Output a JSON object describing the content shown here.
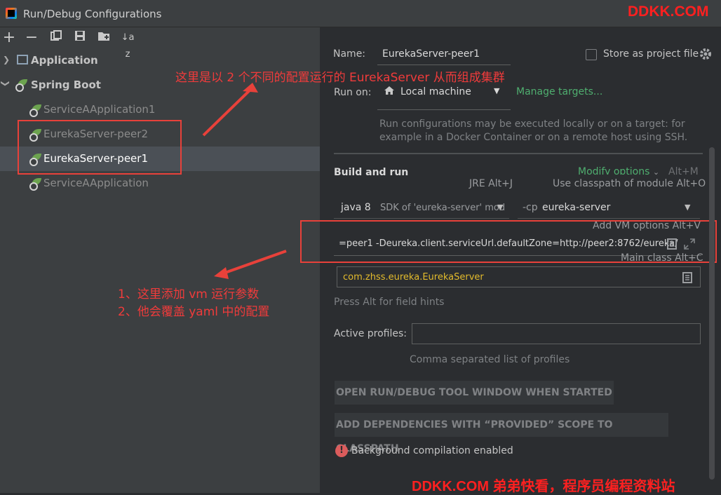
{
  "window": {
    "title": "Run/Debug Configurations"
  },
  "watermark": {
    "top": "DDKK.COM",
    "bottom": "DDKK.COM 弟弟快看，程序员编程资料站"
  },
  "toolbar": {
    "add": "+",
    "remove": "−",
    "copy": "⧉",
    "save": "💾",
    "folder": "📁",
    "sort": "↓a z"
  },
  "tree": {
    "groups": [
      {
        "label": "Application"
      },
      {
        "label": "Spring Boot"
      }
    ],
    "items": [
      {
        "label": "ServiceAApplication1"
      },
      {
        "label": "EurekaServer-peer2"
      },
      {
        "label": "EurekaServer-peer1"
      },
      {
        "label": "ServiceAApplication"
      }
    ]
  },
  "annotations": {
    "top": "这里是以 2 个不同的配置运行的 EurekaServer 从而组成集群",
    "vm_line1": "1、这里添加 vm 运行参数",
    "vm_line2": "2、他会覆盖 yaml 中的配置"
  },
  "form": {
    "name_label": "Name:",
    "name_value": "EurekaServer-peer1",
    "store_label": "Store as project file",
    "run_on_label": "Run on:",
    "run_on_value": "Local machine",
    "manage_targets": "Manage targets...",
    "run_on_hint_1": "Run configurations may be executed locally or on a target: for",
    "run_on_hint_2": "example in a Docker Container or on a remote host using SSH.",
    "build_run_title": "Build and run",
    "modify_options": "Modify options",
    "modify_shortcut": "Alt+M",
    "jre_shortcut": "JRE Alt+J",
    "classpath_shortcut": "Use classpath of module Alt+O",
    "jre_value": "java 8",
    "jre_detail": "SDK of 'eureka-server' mod",
    "cp_prefix": "-cp",
    "cp_value": "eureka-server",
    "vm_shortcut": "Add VM options Alt+V",
    "vm_value": "=peer1 -Deureka.client.serviceUrl.defaultZone=http://peer2:8762/eureka/",
    "main_class_shortcut": "Main class Alt+C",
    "main_class_value": "com.zhss.eureka.EurekaServer",
    "field_hints": "Press Alt for field hints",
    "active_profiles_label": "Active profiles:",
    "active_profiles_value": "",
    "profiles_hint": "Comma separated list of profiles",
    "open_tool_window": "OPEN RUN/DEBUG TOOL WINDOW WHEN STARTED",
    "add_dependencies": "ADD DEPENDENCIES WITH “PROVIDED” SCOPE TO CLASSPATH",
    "bg_compilation": "Background compilation enabled"
  }
}
